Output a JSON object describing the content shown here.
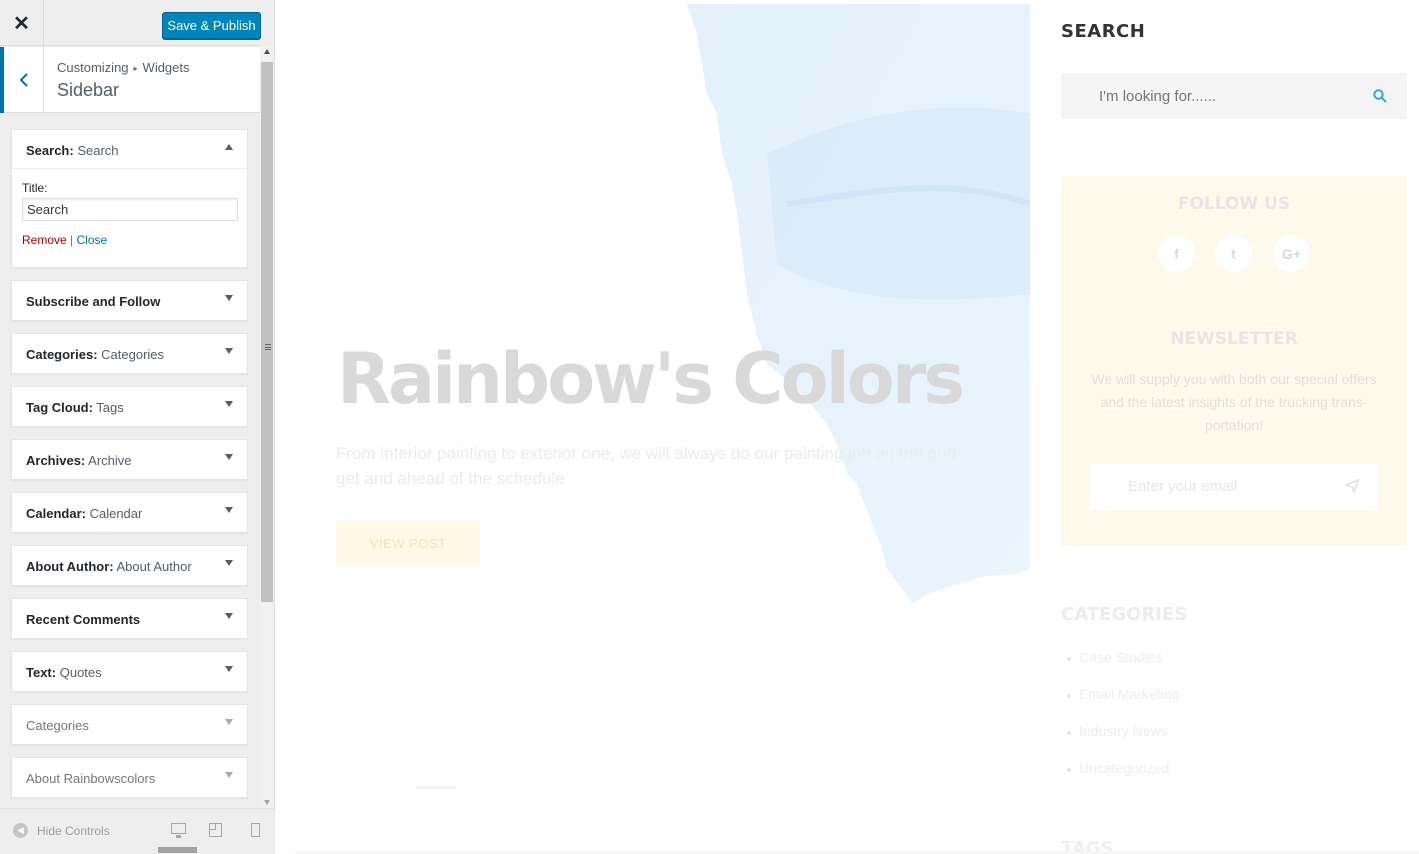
{
  "topbar": {
    "close_icon": "close-icon",
    "publish_label": "Save & Publish"
  },
  "section": {
    "breadcrumb_root": "Customizing",
    "breadcrumb_sep": "▸",
    "breadcrumb_child": "Widgets",
    "title": "Sidebar"
  },
  "widgets": [
    {
      "title": "Search:",
      "instance": " Search",
      "expanded": true
    },
    {
      "title": "Subscribe and Follow",
      "instance": ""
    },
    {
      "title": "Categories:",
      "instance": " Categories"
    },
    {
      "title": "Tag Cloud:",
      "instance": " Tags"
    },
    {
      "title": "Archives:",
      "instance": " Archive"
    },
    {
      "title": "Calendar:",
      "instance": " Calendar"
    },
    {
      "title": "About Author:",
      "instance": " About Author"
    },
    {
      "title": "Recent Comments",
      "instance": ""
    },
    {
      "title": "Text:",
      "instance": " Quotes"
    },
    {
      "title": "Categories",
      "instance": ""
    },
    {
      "title": "About Rainbowscolors",
      "instance": ""
    }
  ],
  "search_widget_form": {
    "title_label": "Title:",
    "title_value": "Search",
    "remove_label": "Remove",
    "separator": "|",
    "close_label": "Close"
  },
  "footer": {
    "hide_label": "Hide Controls"
  },
  "preview": {
    "hero": {
      "title": "Rainbow's Colors",
      "text": "From interior painting to exterior one, we will always do our painting job on the bud get and ahead of the schedule",
      "button": "VIEW POST"
    },
    "search": {
      "title": "SEARCH",
      "placeholder": "I'm looking for......"
    },
    "follow": {
      "title": "FOLLOW US",
      "facebook": "f",
      "twitter": "t",
      "googleplus": "G+"
    },
    "newsletter": {
      "title": "NEWSLETTER",
      "text": "We will supply you with both our special offers and the latest insights of the trucking trans-portation!",
      "placeholder": "Enter your email"
    },
    "categories": {
      "title": "CATEGORIES",
      "items": [
        "Case Studies",
        "Email Marketing",
        "Industry News",
        "Uncategorized"
      ]
    },
    "tags_title": "TAGS"
  },
  "colors": {
    "accent": "#0085ba",
    "link": "#0073aa",
    "remove": "#aa0000",
    "search_icon": "#2ea3f2"
  }
}
